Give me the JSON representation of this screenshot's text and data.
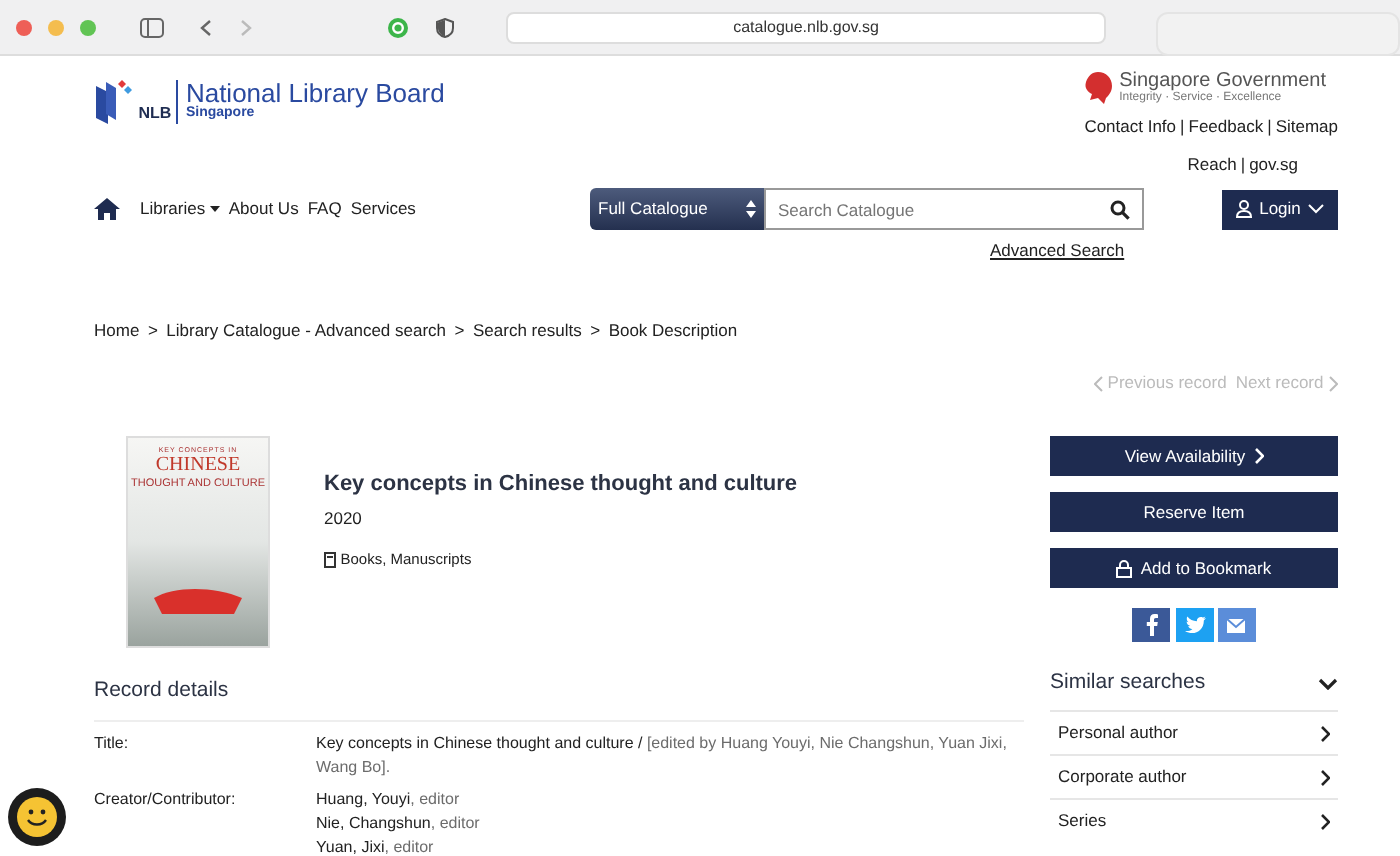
{
  "browser": {
    "url": "catalogue.nlb.gov.sg"
  },
  "header": {
    "logo_short": "NLB",
    "logo_title": "National Library Board",
    "logo_subtitle": "Singapore",
    "gov_title": "Singapore Government",
    "gov_tagline": "Integrity · Service · Excellence",
    "link_separator": "|",
    "links": [
      {
        "label": "Contact Info"
      },
      {
        "label": "Feedback"
      },
      {
        "label": "Sitemap"
      },
      {
        "label": "Reach"
      },
      {
        "label": "gov.sg"
      }
    ]
  },
  "nav": {
    "items": [
      {
        "label": "Libraries",
        "dropdown": true
      },
      {
        "label": "About Us",
        "dropdown": false
      },
      {
        "label": "FAQ",
        "dropdown": false
      },
      {
        "label": "Services",
        "dropdown": false
      }
    ],
    "scope": "Full Catalogue",
    "search_placeholder": "Search Catalogue",
    "advanced": "Advanced Search",
    "login": "Login"
  },
  "breadcrumb_separator": ">",
  "breadcrumb": [
    "Home",
    "Library Catalogue - Advanced search",
    "Search results",
    "Book Description"
  ],
  "pager": {
    "previous": "Previous record",
    "next": "Next record",
    "previous_disabled": true,
    "next_disabled": true
  },
  "book": {
    "cover_top": "KEY CONCEPTS IN",
    "cover_title": "CHINESE",
    "cover_sub": "THOUGHT AND CULTURE",
    "title": "Key concepts in Chinese thought and culture",
    "year": "2020",
    "format": "Books, Manuscripts"
  },
  "actions": [
    "View Availability",
    "Reserve Item",
    "Add to Bookmark"
  ],
  "record": {
    "heading": "Record details",
    "fields": [
      {
        "label": "Title:",
        "values": [
          {
            "main": "Key concepts in Chinese thought and culture / ",
            "extra": "[edited by Huang Youyi, Nie Changshun, Yuan Jixi, Wang Bo]."
          }
        ]
      },
      {
        "label": "Creator/Contributor:",
        "values": [
          {
            "main": "Huang, Youyi",
            "extra": ", editor"
          },
          {
            "main": "Nie, Changshun",
            "extra": ", editor"
          },
          {
            "main": "Yuan, Jixi",
            "extra": ", editor"
          }
        ]
      }
    ]
  },
  "similar": {
    "heading": "Similar searches",
    "expanded": true,
    "items": [
      "Personal author",
      "Corporate author",
      "Series"
    ]
  }
}
